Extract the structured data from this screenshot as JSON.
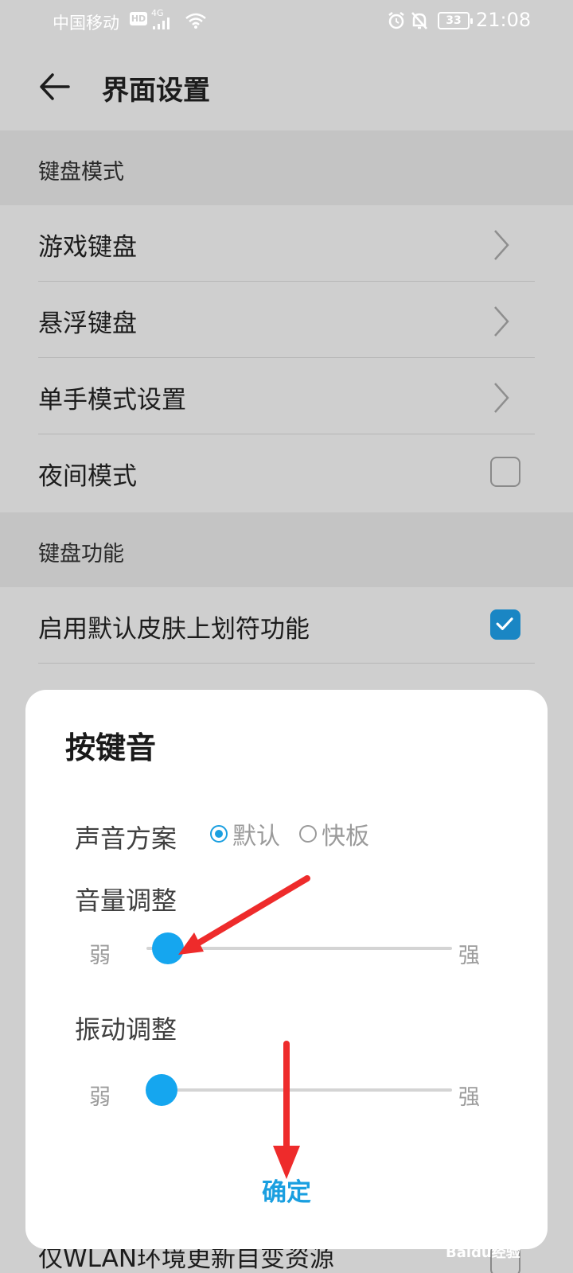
{
  "status_bar": {
    "carrier": "中国移动",
    "hd_badge": "HD",
    "network": "4G",
    "battery": "33",
    "time": "21:08"
  },
  "app_bar": {
    "title": "界面设置"
  },
  "sections": {
    "keyboard_mode": {
      "header": "键盘模式",
      "items": [
        {
          "label": "游戏键盘",
          "control": "chevron"
        },
        {
          "label": "悬浮键盘",
          "control": "chevron"
        },
        {
          "label": "单手模式设置",
          "control": "chevron"
        },
        {
          "label": "夜间模式",
          "control": "checkbox",
          "checked": false
        }
      ]
    },
    "keyboard_function": {
      "header": "键盘功能",
      "items": [
        {
          "label": "启用默认皮肤上划符功能",
          "control": "checkbox",
          "checked": true
        }
      ]
    }
  },
  "bottom_row": {
    "label": "仅WLAN环境更新自变资源",
    "checked": false
  },
  "dialog": {
    "title": "按键音",
    "sound_scheme": {
      "label": "声音方案",
      "options": [
        "默认",
        "快板"
      ],
      "selected": "默认"
    },
    "volume": {
      "label": "音量调整",
      "min_label": "弱",
      "max_label": "强",
      "value": 0.06
    },
    "vibration": {
      "label": "振动调整",
      "min_label": "弱",
      "max_label": "强",
      "value": 0.0
    },
    "confirm": "确定"
  },
  "watermark": "Baidu经验",
  "colors": {
    "accent": "#15a6ef",
    "checkbox_on": "#1a86c4",
    "annotation_arrow": "#ee2b2b"
  }
}
